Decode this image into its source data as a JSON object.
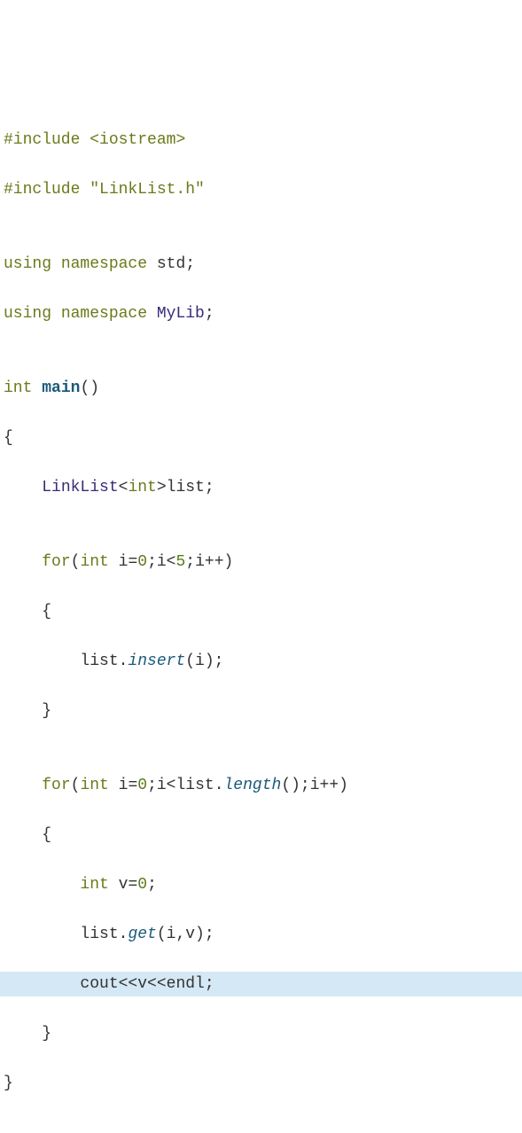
{
  "code": {
    "l1": {
      "pp": "#include ",
      "ang1": "<",
      "hdr": "iostream",
      "ang2": ">"
    },
    "l2": {
      "pp": "#include ",
      "s": "\"LinkList.h\""
    },
    "l3": "",
    "l4": {
      "kw1": "using ",
      "kw2": "namespace ",
      "ns": "std",
      "semi": ";"
    },
    "l5": {
      "kw1": "using ",
      "kw2": "namespace ",
      "ns": "MyLib",
      "semi": ";"
    },
    "l6": "",
    "l7": {
      "kw": "int ",
      "fn": "main",
      "paren": "()"
    },
    "l8": "{",
    "l9": {
      "indent": "    ",
      "type": "LinkList",
      "tpl": "<",
      "targ": "int",
      "tpl2": ">",
      "id": "list;"
    },
    "l10": "",
    "l11": {
      "indent": "    ",
      "kw": "for",
      "open": "(",
      "kw2": "int ",
      "init": "i=",
      "n0": "0",
      "semi1": ";i<",
      "n5": "5",
      "rest": ";i++)"
    },
    "l12": {
      "indent": "    ",
      "brace": "{"
    },
    "l13": {
      "indent": "        ",
      "obj": "list.",
      "call": "insert",
      "args": "(i);"
    },
    "l14": {
      "indent": "    ",
      "brace": "}"
    },
    "l15": "",
    "l16": {
      "indent": "    ",
      "kw": "for",
      "open": "(",
      "kw2": "int ",
      "init": "i=",
      "n0": "0",
      "semi1": ";i<list.",
      "call": "length",
      "rest": "();i++)"
    },
    "l17": {
      "indent": "    ",
      "brace": "{"
    },
    "l18": {
      "indent": "        ",
      "kw": "int ",
      "id": "v=",
      "n0": "0",
      "semi": ";"
    },
    "l19": {
      "indent": "        ",
      "obj": "list.",
      "call": "get",
      "args": "(i,v);"
    },
    "l20": {
      "indent": "        ",
      "txt": "cout<<v<<endl;"
    },
    "l21": {
      "indent": "    ",
      "brace": "}"
    },
    "l22": "}"
  }
}
